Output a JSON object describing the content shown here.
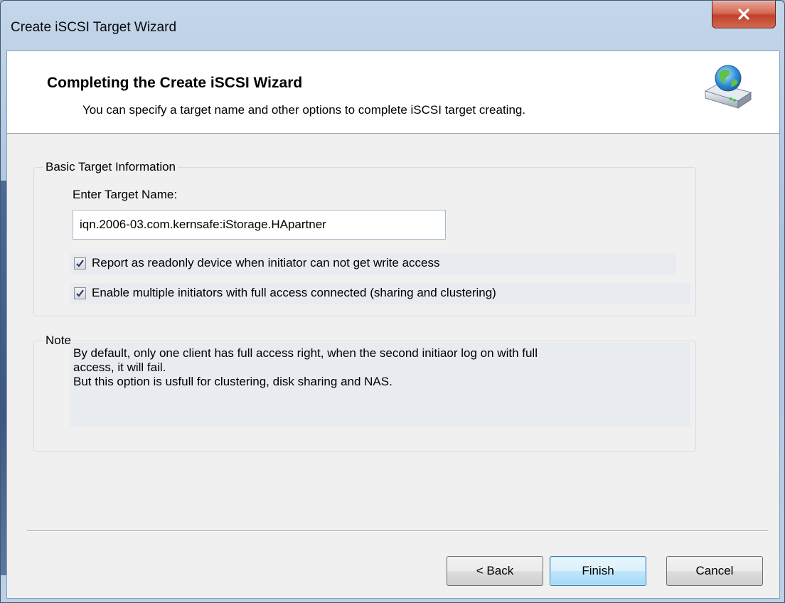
{
  "window": {
    "title": "Create iSCSI Target Wizard",
    "close_label": "X"
  },
  "header": {
    "title": "Completing the Create iSCSI Wizard",
    "subtitle": "You can specify a target name and other options to complete iSCSI target creating.",
    "icon": "network-drive-globe-icon"
  },
  "basic": {
    "group_label": "Basic Target Information",
    "name_label": "Enter Target Name:",
    "name_value": "iqn.2006-03.com.kernsafe:iStorage.HApartner",
    "options": [
      {
        "label": "Report as readonly device when initiator can not get write access",
        "checked": true
      },
      {
        "label": "Enable multiple initiators with  full access connected (sharing and clustering)",
        "checked": true
      }
    ]
  },
  "note": {
    "group_label": "Note",
    "lines": [
      "By default, only one client has full access right, when the second initiaor log on with full",
      "access, it will fail.",
      "But this option is usfull for clustering, disk sharing and NAS."
    ]
  },
  "buttons": {
    "back": "< Back",
    "finish": "Finish",
    "cancel": "Cancel"
  },
  "colors": {
    "title_bar": "#bcd0e6",
    "close_button": "#c1412a",
    "default_button_border": "#3c7fb1"
  }
}
